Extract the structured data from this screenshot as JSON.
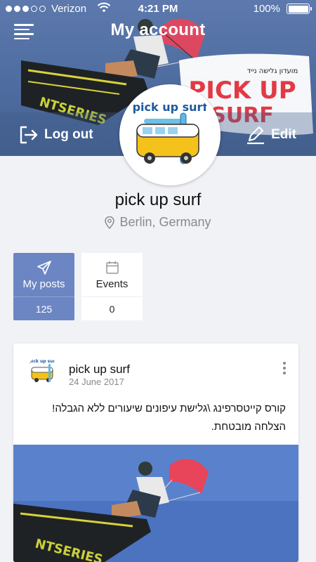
{
  "status_bar": {
    "carrier": "Verizon",
    "time": "4:21 PM",
    "battery": "100%"
  },
  "header": {
    "title": "My account",
    "logout_label": "Log out",
    "edit_label": "Edit"
  },
  "cover": {
    "banner_subtitle": "מועדון גלישה נייד",
    "banner_title_line1": "PICK UP",
    "banner_title_line2": "SURF"
  },
  "avatar": {
    "logo_text": "pick up surf"
  },
  "profile": {
    "name": "pick up surf",
    "location": "Berlin, Germany"
  },
  "tabs": [
    {
      "label": "My posts",
      "count": "125",
      "icon": "send-icon"
    },
    {
      "label": "Events",
      "count": "0",
      "icon": "calendar-icon"
    }
  ],
  "post": {
    "author": "pick up surf",
    "date": "24 June 2017",
    "text": "קורס קייטסרפינג \\גלישת עיפונים שיעורים ללא הגבלה! הצלחה מובטחת."
  },
  "colors": {
    "header_blue": "#4e6c9f",
    "tab_active": "#6c86c4",
    "background": "#f1f2f6"
  }
}
